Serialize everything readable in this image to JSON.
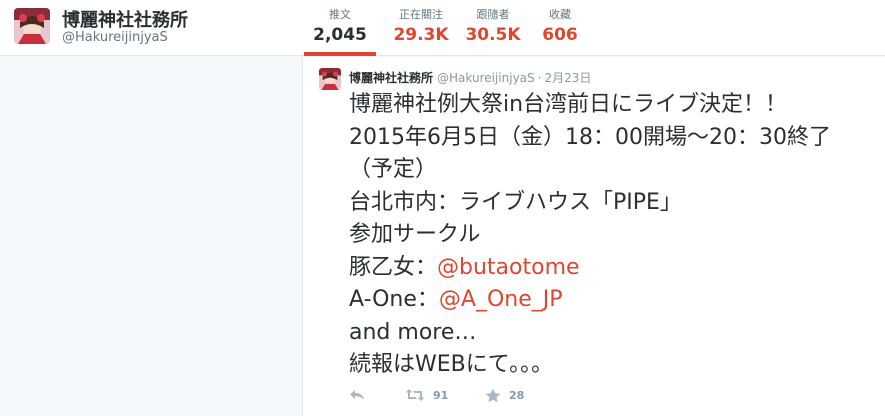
{
  "profile": {
    "name": "博麗神社社務所",
    "handle": "@HakureijinjyaS"
  },
  "stats": [
    {
      "label": "推文",
      "value": "2,045"
    },
    {
      "label": "正在關注",
      "value": "29.3K"
    },
    {
      "label": "跟隨者",
      "value": "30.5K"
    },
    {
      "label": "收藏",
      "value": "606"
    }
  ],
  "tweet": {
    "name": "博麗神社社務所",
    "handle": "@HakureijinjyaS",
    "separator": "·",
    "time": "2月23日",
    "lines": {
      "l1": "博麗神社例大祭in台湾前日にライブ決定！！",
      "l2": "2015年6月5日（金）18：00開場～20：30終了",
      "l3": "（予定）",
      "l4": "台北市内：ライブハウス「PIPE」",
      "l5": "参加サークル",
      "l6_prefix": "豚乙女：",
      "l6_mention": "@butaotome",
      "l7_prefix": "A-One：",
      "l7_mention": "@A_One_JP",
      "l8": "and more…",
      "l9": "続報はWEBにて。。。"
    },
    "retweet_count": "91",
    "favorite_count": "28"
  },
  "icons": {
    "reply": "reply-icon",
    "retweet": "retweet-icon",
    "favorite": "star-icon"
  },
  "colors": {
    "accent": "#e0462f",
    "muted": "#8899a6"
  }
}
